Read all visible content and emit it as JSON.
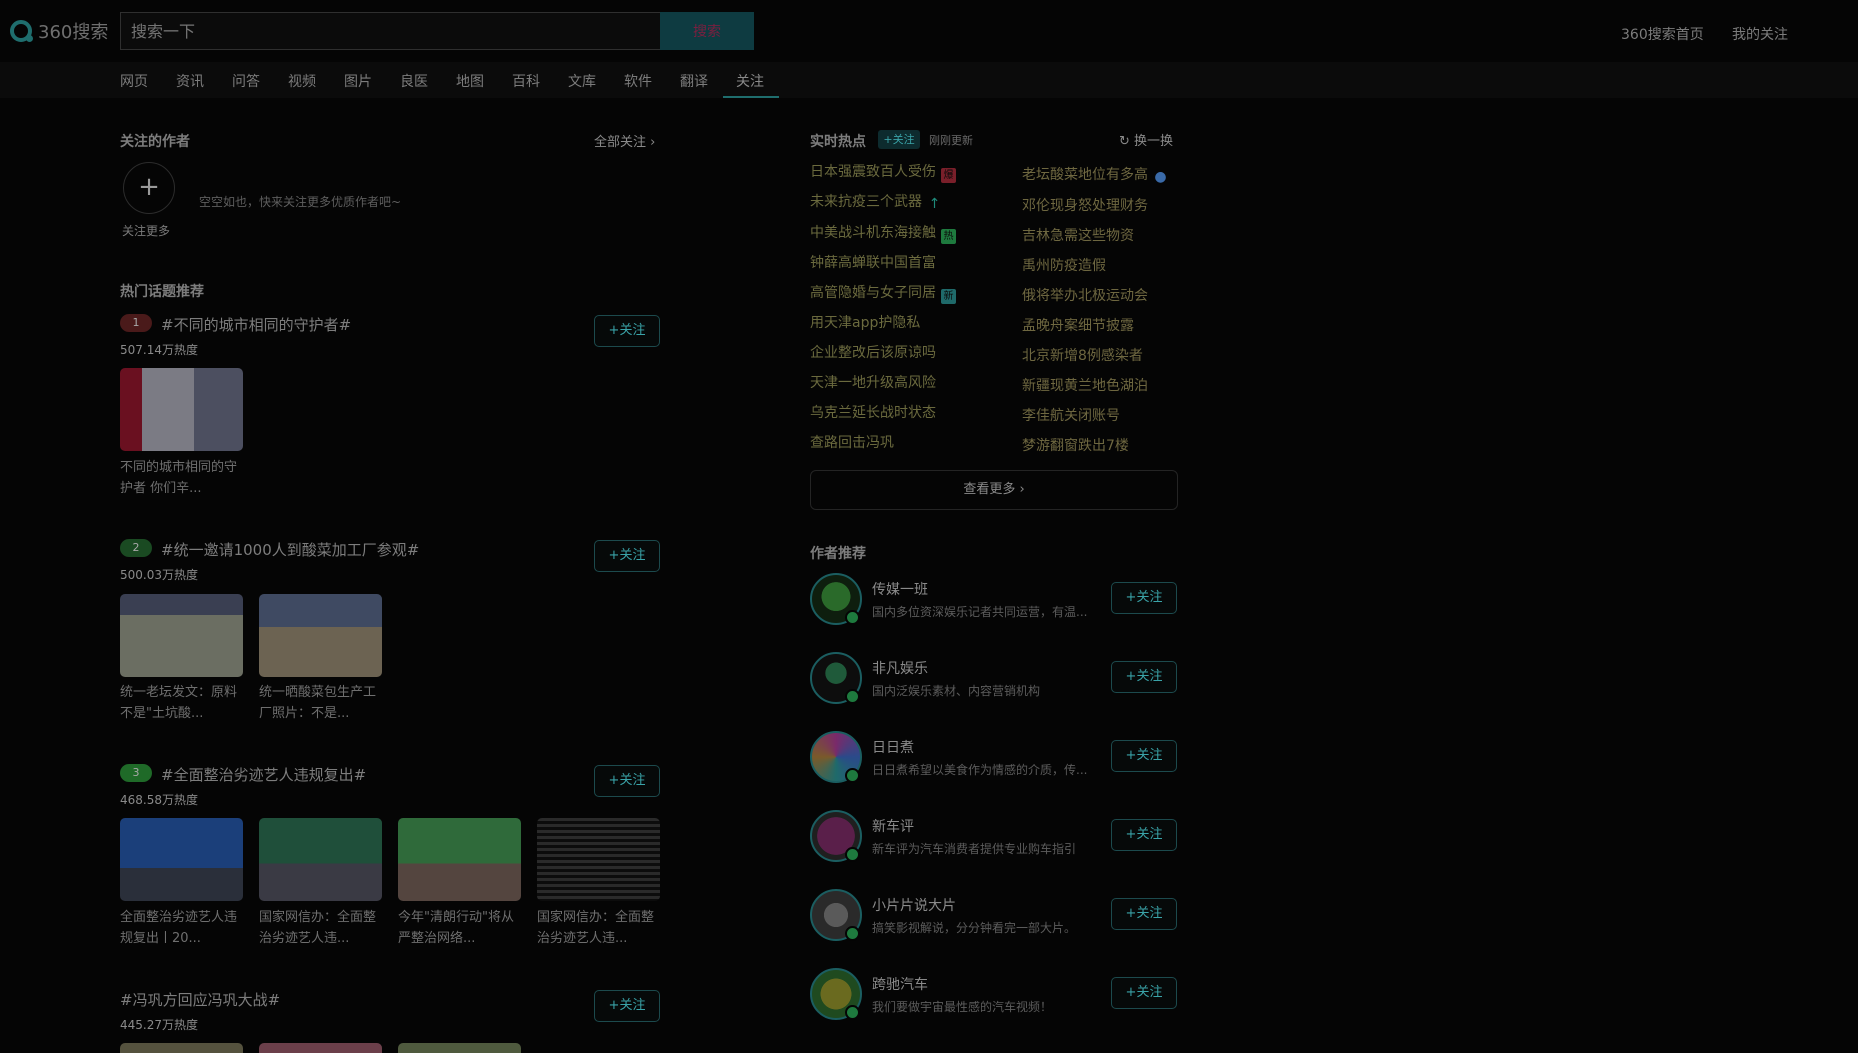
{
  "header": {
    "logo_text": "360搜索",
    "search_placeholder": "搜索一下",
    "search_button": "搜索",
    "links": [
      "360搜索首页",
      "我的关注"
    ]
  },
  "tabs": [
    "网页",
    "资讯",
    "问答",
    "视频",
    "图片",
    "良医",
    "地图",
    "百科",
    "文库",
    "软件",
    "翻译",
    "关注"
  ],
  "active_tab": "关注",
  "followed_authors": {
    "title": "关注的作者",
    "all_label": "全部关注",
    "add_label": "关注更多",
    "empty_message": "空空如也，快来关注更多优质作者吧~"
  },
  "hot_topics": {
    "title": "热门话题推荐",
    "follow_label": "+关注",
    "items": [
      {
        "rank": "1",
        "title": "#不同的城市相同的守护者#",
        "heat": "507.14万热度",
        "posts": [
          {
            "caption": "不同的城市相同的守护者 你们辛..."
          }
        ]
      },
      {
        "rank": "2",
        "title": "#统一邀请1000人到酸菜加工厂参观#",
        "heat": "500.03万热度",
        "posts": [
          {
            "caption": "统一老坛发文：原料不是\"土坑酸..."
          },
          {
            "caption": "统一晒酸菜包生产工厂照片：不是..."
          }
        ]
      },
      {
        "rank": "3",
        "title": "#全面整治劣迹艺人违规复出#",
        "heat": "468.58万热度",
        "posts": [
          {
            "caption": "全面整治劣迹艺人违规复出丨20..."
          },
          {
            "caption": "国家网信办：全面整治劣迹艺人违..."
          },
          {
            "caption": "今年\"清朗行动\"将从严整治网络..."
          },
          {
            "caption": "国家网信办：全面整治劣迹艺人违..."
          }
        ]
      },
      {
        "rank": "",
        "title": "#冯巩方回应冯巩大战#",
        "heat": "445.27万热度",
        "posts": []
      }
    ]
  },
  "realtime_hot": {
    "title": "实时热点",
    "follow_label": "+关注",
    "updated": "刚刚更新",
    "refresh_label": "换一换",
    "left": [
      {
        "text": "日本强震致百人受伤",
        "tag": "爆"
      },
      {
        "text": "未来抗疫三个武器",
        "tag": "↑"
      },
      {
        "text": "中美战斗机东海接触",
        "tag": "热"
      },
      {
        "text": "钟薛高蝉联中国首富",
        "tag": ""
      },
      {
        "text": "高管隐婚与女子同居",
        "tag": "新"
      },
      {
        "text": "用天津app护隐私",
        "tag": ""
      },
      {
        "text": "企业整改后该原谅吗",
        "tag": ""
      },
      {
        "text": "天津一地升级高风险",
        "tag": ""
      },
      {
        "text": "乌克兰延长战时状态",
        "tag": ""
      },
      {
        "text": "查路回击冯巩",
        "tag": ""
      }
    ],
    "right": [
      {
        "text": "老坛酸菜地位有多高",
        "tag": "●"
      },
      {
        "text": "邓伦现身怒处理财务",
        "tag": ""
      },
      {
        "text": "吉林急需这些物资",
        "tag": ""
      },
      {
        "text": "禹州防疫造假",
        "tag": ""
      },
      {
        "text": "俄将举办北极运动会",
        "tag": ""
      },
      {
        "text": "孟晚舟案细节披露",
        "tag": ""
      },
      {
        "text": "北京新增8例感染者",
        "tag": ""
      },
      {
        "text": "新疆现黄兰地色湖泊",
        "tag": ""
      },
      {
        "text": "李佳航关闭账号",
        "tag": ""
      },
      {
        "text": "梦游翻窗跌出7楼",
        "tag": ""
      }
    ],
    "more_label": "查看更多"
  },
  "author_recommend": {
    "title": "作者推荐",
    "follow_label": "+关注",
    "items": [
      {
        "name": "传媒一班",
        "desc": "国内多位资深娱乐记者共同运营，有温..."
      },
      {
        "name": "非凡娱乐",
        "desc": "国内泛娱乐素材、内容营销机构"
      },
      {
        "name": "日日煮",
        "desc": "日日煮希望以美食作为情感的介质，传..."
      },
      {
        "name": "新车评",
        "desc": "新车评为汽车消费者提供专业购车指引"
      },
      {
        "name": "小片片说大片",
        "desc": "搞笑影视解说，分分钟看完一部大片。"
      },
      {
        "name": "跨驰汽车",
        "desc": "我们要做宇宙最性感的汽车视频！"
      }
    ]
  },
  "colors": {
    "background": "#050505",
    "accent": "#1f6e6e",
    "hot_text": "#6b6a3e"
  }
}
